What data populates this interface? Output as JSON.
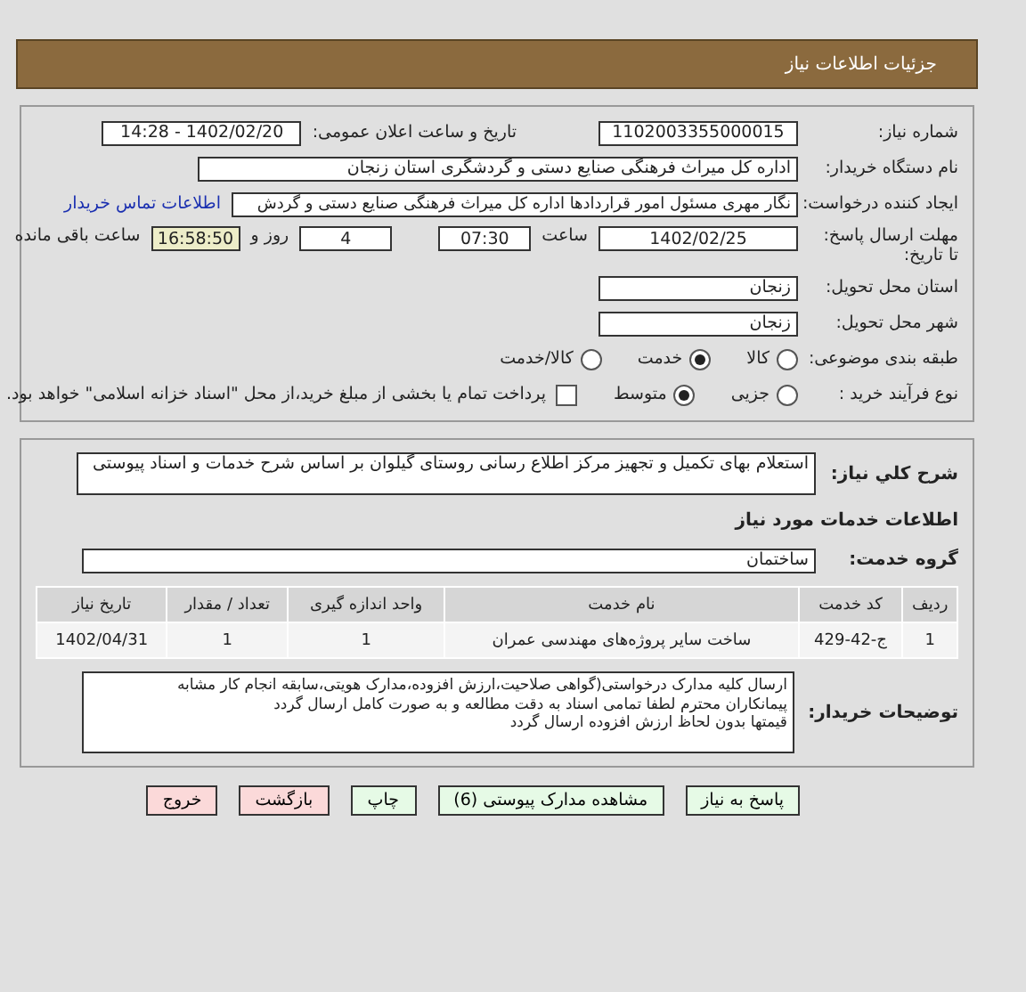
{
  "header": {
    "title": "جزئيات اطلاعات نياز"
  },
  "need_number": {
    "label": "شماره نیاز:",
    "value": "1102003355000015"
  },
  "announce": {
    "label": "تاریخ و ساعت اعلان عمومی:",
    "value": "1402/02/20 - 14:28"
  },
  "buyer": {
    "label": "نام دستگاه خریدار:",
    "value": "اداره کل میراث فرهنگی  صنایع دستی و گردشگری استان زنجان"
  },
  "requester": {
    "label": "ایجاد کننده درخواست:",
    "value": "نگار مهری مسئول امور قراردادها اداره کل میراث فرهنگی  صنایع دستی و گردش",
    "link": "اطلاعات تماس خریدار"
  },
  "deadline": {
    "label": "مهلت ارسال پاسخ: تا تاریخ:",
    "date": "1402/02/25",
    "time_label": "ساعت",
    "time": "07:30",
    "days": "4",
    "days_label": "روز و",
    "remaining": "16:58:50",
    "remaining_label": "ساعت باقی مانده"
  },
  "province": {
    "label": "استان محل تحویل:",
    "value": "زنجان"
  },
  "city": {
    "label": "شهر محل تحویل:",
    "value": "زنجان"
  },
  "category": {
    "label": "طبقه بندی موضوعی:",
    "options": [
      {
        "label": "کالا",
        "selected": false
      },
      {
        "label": "خدمت",
        "selected": true
      },
      {
        "label": "کالا/خدمت",
        "selected": false
      }
    ]
  },
  "process": {
    "label": "نوع فرآیند خرید :",
    "options": [
      {
        "label": "جزیی",
        "selected": false
      },
      {
        "label": "متوسط",
        "selected": true
      }
    ],
    "payment_checkbox": {
      "checked": false,
      "text": "پرداخت تمام یا بخشی از مبلغ خرید،از محل \"اسناد خزانه اسلامی\" خواهد بود."
    }
  },
  "summary": {
    "label": "شرح کلي نیاز:",
    "value": "استعلام بهای تکمیل و تجهیز مرکز اطلاع رسانی روستای گیلوان بر اساس شرح خدمات و اسناد پیوستی"
  },
  "services_title": "اطلاعات خدمات مورد نیاز",
  "service_group": {
    "label": "گروه خدمت:",
    "value": "ساختمان"
  },
  "table": {
    "columns": [
      "ردیف",
      "کد خدمت",
      "نام خدمت",
      "واحد اندازه گیری",
      "تعداد / مقدار",
      "تاریخ نیاز"
    ],
    "rows": [
      [
        "1",
        "ج-42-429",
        "ساخت سایر پروژه‌های مهندسی عمران",
        "1",
        "1",
        "1402/04/31"
      ]
    ]
  },
  "buyer_notes": {
    "label": "توضیحات خریدار:",
    "lines": [
      "ارسال کلیه مدارک درخواستی(گواهی صلاحیت،ارزش افزوده،مدارک هویتی،سابقه انجام کار مشابه",
      "پیمانکاران محترم لطفا تمامی اسناد به دقت مطالعه و به صورت کامل ارسال گردد",
      "قیمتها بدون لحاظ ارزش افزوده ارسال گردد"
    ]
  },
  "buttons": [
    {
      "label": "پاسخ به نیاز",
      "kind": "primary"
    },
    {
      "label": "مشاهده مدارک پیوستی (6)",
      "kind": "primary"
    },
    {
      "label": "چاپ",
      "kind": "primary"
    },
    {
      "label": "بازگشت",
      "kind": "danger"
    },
    {
      "label": "خروج",
      "kind": "danger"
    }
  ]
}
